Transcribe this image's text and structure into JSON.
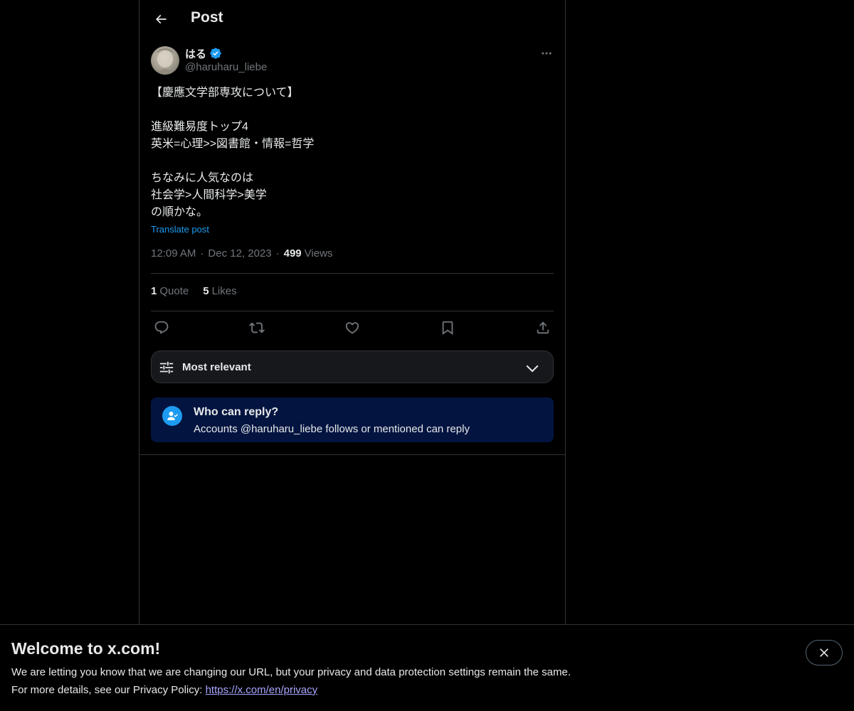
{
  "header": {
    "title": "Post"
  },
  "author": {
    "display_name": "はる",
    "handle": "@haruharu_liebe"
  },
  "tweet": {
    "text": "【慶應文学部専攻について】\n\n進級難易度トップ4\n英米=心理>>図書館・情報=哲学\n\nちなみに人気なのは\n社会学>人間科学>美学\nの順かな。",
    "translate_label": "Translate post",
    "time": "12:09 AM",
    "date": "Dec 12, 2023",
    "views_count": "499",
    "views_label": "Views"
  },
  "stats": {
    "quotes_count": "1",
    "quotes_label": "Quote",
    "likes_count": "5",
    "likes_label": "Likes"
  },
  "sort": {
    "label": "Most relevant"
  },
  "reply_restriction": {
    "title": "Who can reply?",
    "description": "Accounts @haruharu_liebe follows or mentioned can reply"
  },
  "banner": {
    "title": "Welcome to x.com!",
    "line1": "We are letting you know that we are changing our URL, but your privacy and data protection settings remain the same.",
    "line2_prefix": "For more details, see our Privacy Policy: ",
    "link": "https://x.com/en/privacy"
  },
  "colors": {
    "accent": "#1d9bf0",
    "background": "#000000",
    "border": "#2f3336",
    "muted_text": "#71767b",
    "reply_box_bg": "#031440"
  },
  "icons": {
    "back": "arrow-left-icon",
    "verified": "verified-badge-icon",
    "more": "more-horizontal-icon",
    "reply": "reply-icon",
    "repost": "repost-icon",
    "like": "heart-icon",
    "bookmark": "bookmark-icon",
    "share": "share-icon",
    "sort": "sliders-icon",
    "chevron": "chevron-down-icon",
    "reply_restriction": "person-check-icon",
    "close": "close-icon"
  }
}
